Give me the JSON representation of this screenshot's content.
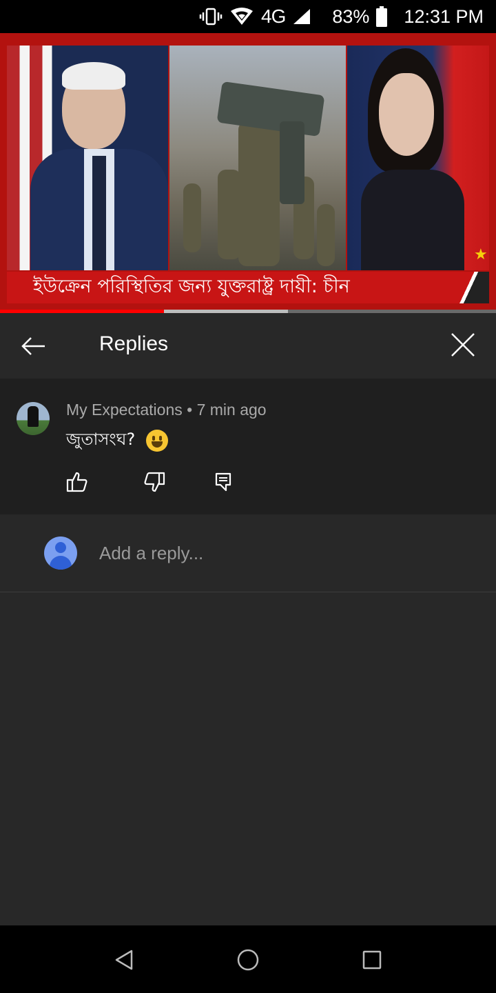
{
  "status_bar": {
    "network": "4G",
    "battery": "83%",
    "time": "12:31 PM"
  },
  "video": {
    "headline": "ইউক্রেন পরিস্থিতির জন্য যুক্তরাষ্ট্র দায়ী: চীন",
    "progress_played": 0.33,
    "progress_buffered": 0.58
  },
  "replies_header": {
    "title": "Replies"
  },
  "comment": {
    "author": "My Expectations",
    "separator": "•",
    "time_ago": "7 min ago",
    "text": "জুতাসংঘ?"
  },
  "reply_box": {
    "placeholder": "Add a reply..."
  },
  "colors": {
    "accent_red": "#ff0000",
    "panel_bg": "#282828",
    "comment_bg": "#1f1f1f"
  }
}
